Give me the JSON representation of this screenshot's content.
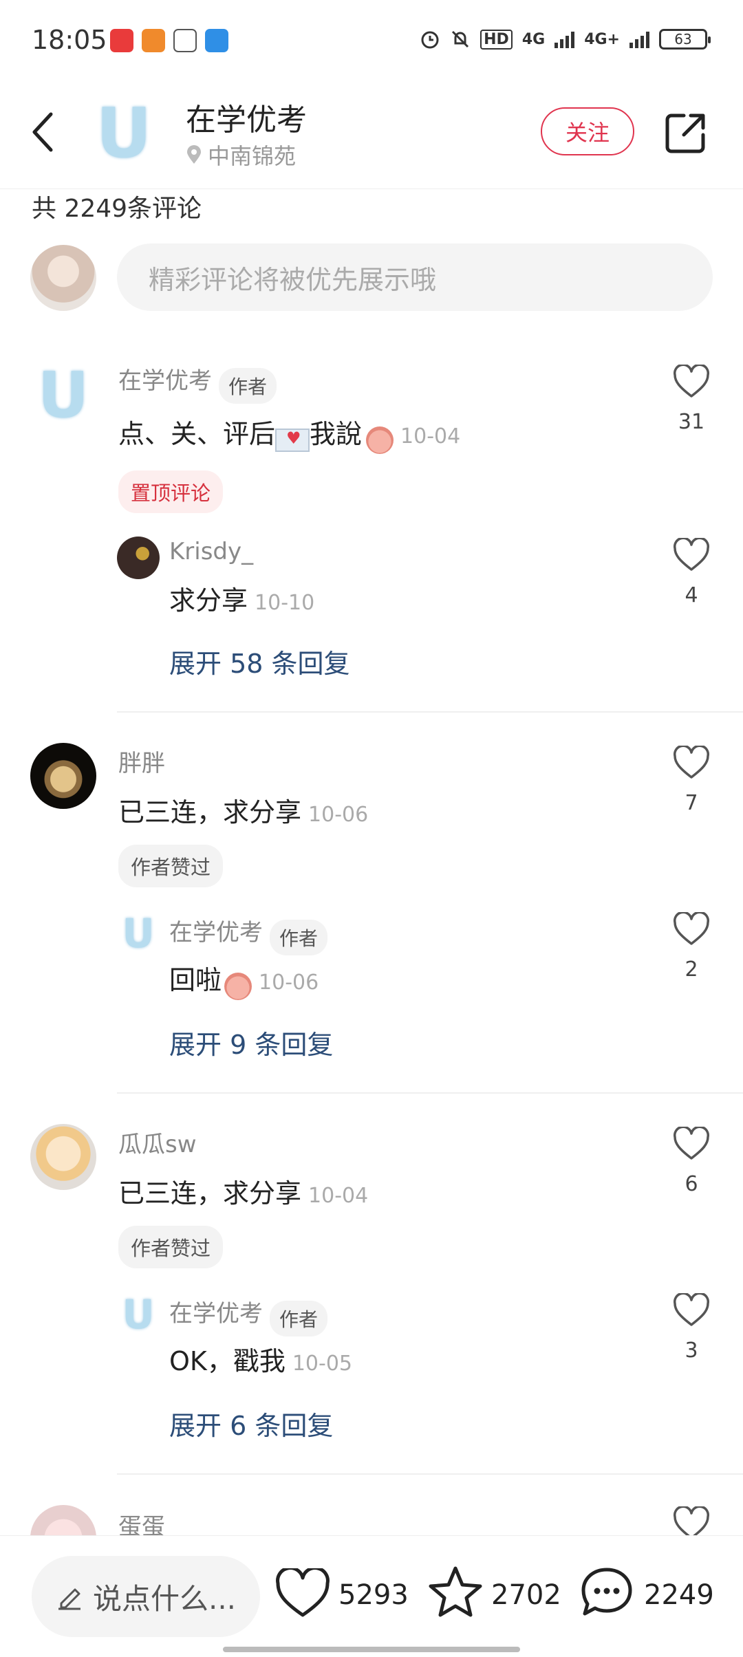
{
  "status_bar": {
    "time": "18:05",
    "battery": "63",
    "net1": "4G",
    "net2": "4G+",
    "hd": "HD"
  },
  "header": {
    "title": "在学优考",
    "location": "中南锦苑",
    "follow_label": "关注"
  },
  "comment_count_text": "共 2249条评论",
  "comment_input": {
    "placeholder": "精彩评论将被优先展示哦"
  },
  "comments": [
    {
      "name": "在学优考",
      "author_tag": "作者",
      "text": "点、关、评后",
      "text_suffix": "我說",
      "date": "10-04",
      "likes": "31",
      "pill": "置顶评论",
      "reply": {
        "name": "Krisdy_",
        "text": "求分享",
        "date": "10-10",
        "likes": "4"
      },
      "expand": "展开 58 条回复"
    },
    {
      "name": "胖胖",
      "text": "已三连，求分享",
      "date": "10-06",
      "likes": "7",
      "pill": "作者赞过",
      "reply": {
        "name": "在学优考",
        "author_tag": "作者",
        "text": "回啦",
        "date": "10-06",
        "likes": "2"
      },
      "expand": "展开 9 条回复"
    },
    {
      "name": "瓜瓜sw",
      "text": "已三连，求分享",
      "date": "10-04",
      "likes": "6",
      "pill": "作者赞过",
      "reply": {
        "name": "在学优考",
        "author_tag": "作者",
        "text": "OK，戳我",
        "date": "10-05",
        "likes": "3"
      },
      "expand": "展开 6 条回复"
    },
    {
      "name": "蛋蛋"
    }
  ],
  "bottom_bar": {
    "say_label": "说点什么...",
    "likes": "5293",
    "favorites": "2702",
    "comments": "2249"
  },
  "colors": {
    "accent": "#e0344e",
    "link": "#2c4d78"
  }
}
